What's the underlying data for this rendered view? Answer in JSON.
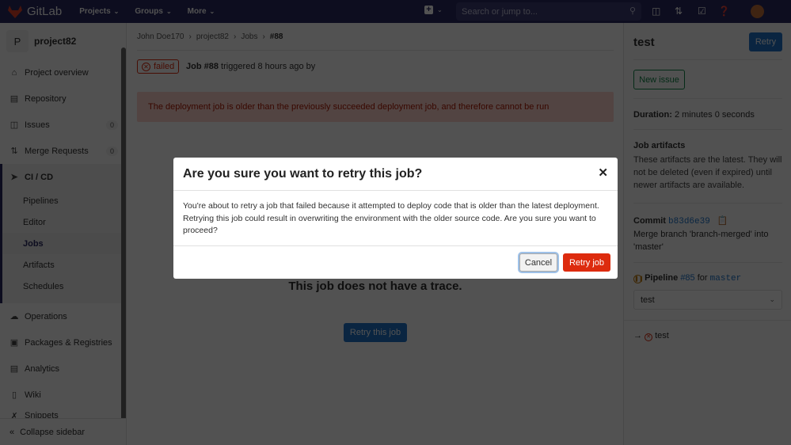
{
  "topbar": {
    "brand": "GitLab",
    "nav": [
      {
        "label": "Projects"
      },
      {
        "label": "Groups"
      },
      {
        "label": "More"
      }
    ],
    "search_placeholder": "Search or jump to..."
  },
  "sidebar": {
    "project_initial": "P",
    "project_name": "project82",
    "items": [
      {
        "label": "Project overview",
        "icon": "home-icon"
      },
      {
        "label": "Repository",
        "icon": "doc-icon"
      },
      {
        "label": "Issues",
        "icon": "issues-icon",
        "count": "0"
      },
      {
        "label": "Merge Requests",
        "icon": "merge-request-icon",
        "count": "0"
      }
    ],
    "cicd": {
      "label": "CI / CD",
      "sub": [
        "Pipelines",
        "Editor",
        "Jobs",
        "Artifacts",
        "Schedules"
      ],
      "active": "Jobs"
    },
    "items2": [
      {
        "label": "Operations"
      },
      {
        "label": "Packages & Registries"
      },
      {
        "label": "Analytics"
      },
      {
        "label": "Wiki"
      },
      {
        "label": "Snippets"
      }
    ],
    "collapse": "Collapse sidebar"
  },
  "breadcrumb": [
    "John Doe170",
    "project82",
    "Jobs",
    "#88"
  ],
  "job": {
    "status": "failed",
    "title": "Job #88",
    "triggered": "triggered 8 hours ago by",
    "alert": "The deployment job is older than the previously succeeded deployment job, and therefore cannot be run",
    "no_trace": "This job does not have a trace.",
    "retry_this": "Retry this job"
  },
  "right": {
    "title": "test",
    "retry": "Retry",
    "new_issue": "New issue",
    "duration_label": "Duration:",
    "duration": "2 minutes 0 seconds",
    "artifacts_title": "Job artifacts",
    "artifacts_text": "These artifacts are the latest. They will not be deleted (even if expired) until newer artifacts are available.",
    "commit_label": "Commit",
    "commit_sha": "b83d6e39",
    "commit_msg": "Merge branch 'branch-merged' into 'master'",
    "pipeline_label": "Pipeline",
    "pipeline_id": "#85",
    "pipeline_for": "for",
    "pipeline_ref": "master",
    "stage_select": "test",
    "job_item": "test"
  },
  "modal": {
    "title": "Are you sure you want to retry this job?",
    "body": "You're about to retry a job that failed because it attempted to deploy code that is older than the latest deployment. Retrying this job could result in overwriting the environment with the older source code. Are you sure you want to proceed?",
    "cancel": "Cancel",
    "confirm": "Retry job"
  }
}
